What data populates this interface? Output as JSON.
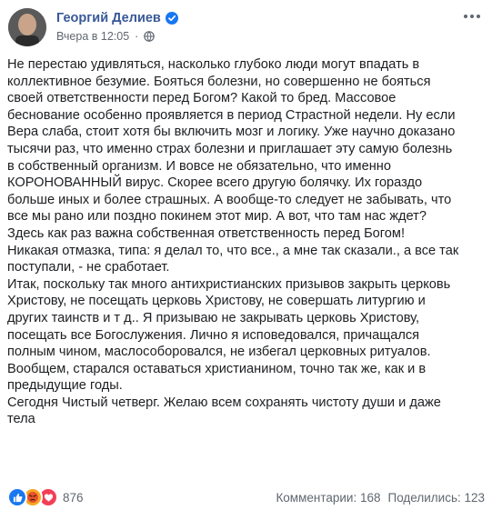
{
  "post": {
    "author": "Георгий Делиев",
    "timestamp": "Вчера в 12:05",
    "separator": "·",
    "lines": [
      "Не перестаю удивляться, насколько глубоко люди могут впадать в",
      "коллективное безумие. Бояться болезни, но совершенно не бояться",
      "своей ответственности перед Богом? Какой то бред. Массовое",
      "беснование особенно проявляется в период Страстной недели. Ну если",
      "Вера слаба, стоит хотя бы включить мозг и логику. Уже научно доказано",
      "тысячи раз, что именно страх болезни и приглашает эту самую болезнь",
      "в собственный организм. И вовсе не обязательно, что именно",
      "КОРОНОВАННЫЙ вирус. Скорее всего другую болячку. Их гораздо",
      "больше иных и более страшных. А вообще-то следует не забывать, что",
      "все мы рано или поздно покинем этот мир. А вот, что там нас ждет?",
      "Здесь как раз важна собственная ответственность перед Богом!",
      "Никакая отмазка, типа: я делал то, что все., а мне так сказали., а все так",
      "поступали, - не сработает.",
      "Итак, поскольку так много антихристианских призывов закрыть церковь",
      "Христову, не посещать церковь Христову, не совершать литургию и",
      "других таинств и т д.. Я призываю не закрывать церковь Христову,",
      "посещать все Богослужения. Лично я исповедовался, причащался",
      "полным чином, маслособоровался, не избегал церковных ритуалов.",
      "Вообщем, старался оставаться христианином, точно так же, как и в",
      "предыдущие годы.",
      "Сегодня Чистый четверг. Желаю всем сохранять чистоту души и даже",
      "тела"
    ]
  },
  "footer": {
    "reactions_count": "876",
    "comments": "Комментарии: 168",
    "shares": "Поделились: 123"
  },
  "icons": {
    "verified": "verified-badge-icon",
    "privacy": "globe-icon",
    "menu": "more-options-icon",
    "reactions": [
      "like-reaction-icon",
      "angry-reaction-icon",
      "love-reaction-icon"
    ]
  },
  "colors": {
    "author_link": "#385898",
    "secondary_text": "#606770",
    "like": "#1877f2",
    "angry": "#f5a623",
    "love": "#f33e58"
  }
}
